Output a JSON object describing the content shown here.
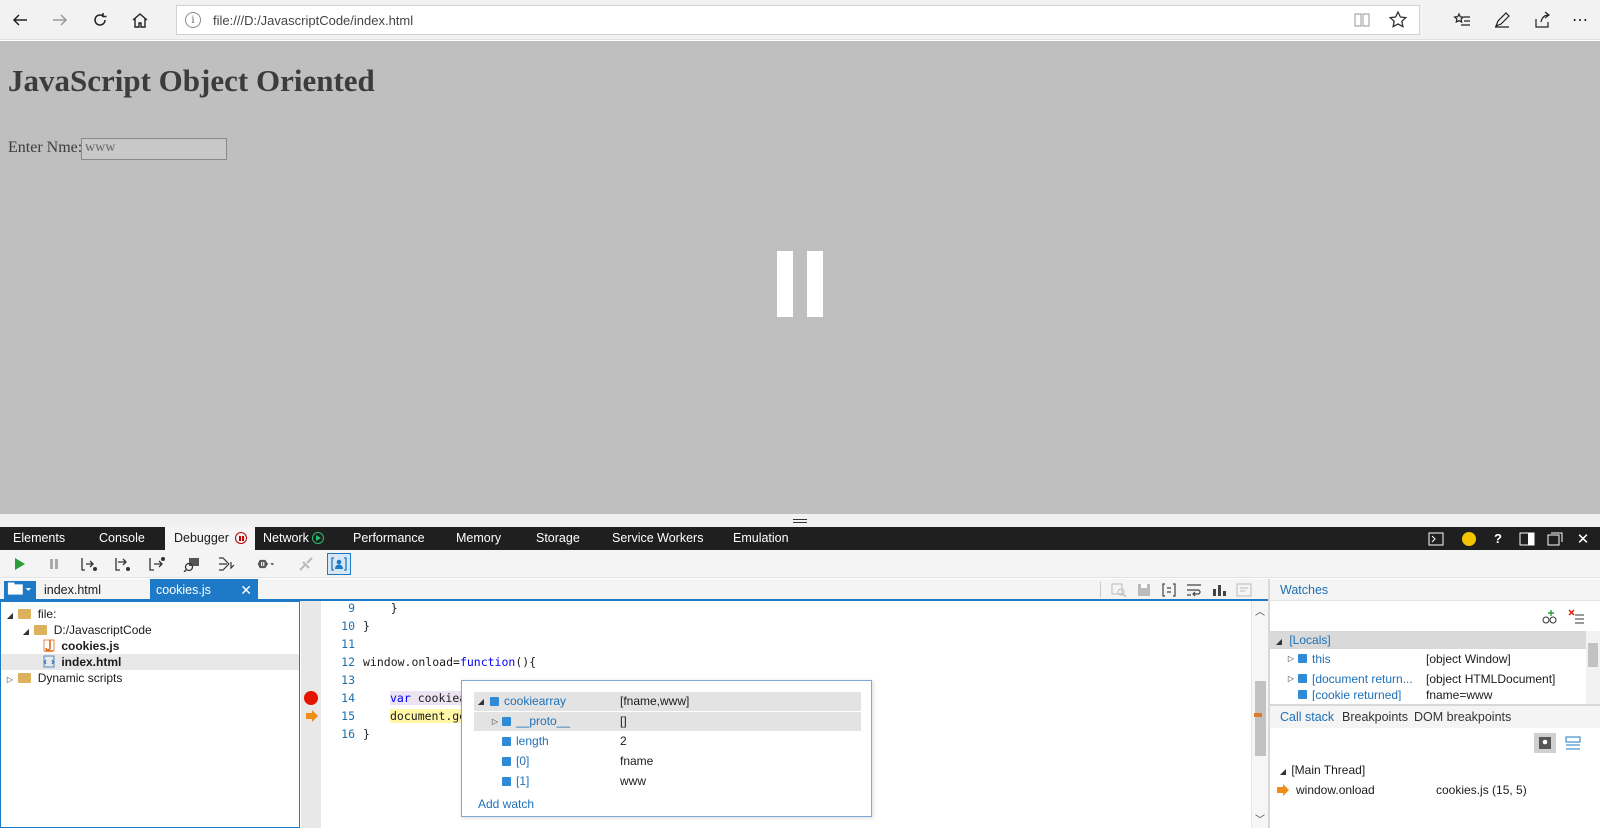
{
  "browser": {
    "url": "file:///D:/JavascriptCode/index.html"
  },
  "page": {
    "heading": "JavaScript Object Oriented",
    "label": "Enter Nme:",
    "input_value": "www"
  },
  "devtools": {
    "tabs": [
      "Elements",
      "Console",
      "Debugger",
      "Network",
      "Performance",
      "Memory",
      "Storage",
      "Service Workers",
      "Emulation"
    ],
    "active_tab": "Debugger"
  },
  "files": {
    "tabs": [
      "index.html",
      "cookies.js"
    ],
    "active": "cookies.js",
    "tree": {
      "root": "file:",
      "folder": "D:/JavascriptCode",
      "file1": "cookies.js",
      "file2": "index.html",
      "dynamic": "Dynamic scripts"
    }
  },
  "code": {
    "lines": [
      {
        "n": "9",
        "text": "    }"
      },
      {
        "n": "10",
        "text": "}"
      },
      {
        "n": "11",
        "text": ""
      },
      {
        "n": "12",
        "pre": "window.onload=",
        "kw": "function",
        "post": "(){"
      },
      {
        "n": "13",
        "text": ""
      },
      {
        "n": "14",
        "kw": "var",
        "post": " cookiea"
      },
      {
        "n": "15",
        "hl": "document.ge"
      },
      {
        "n": "16",
        "text": "}"
      }
    ]
  },
  "datatip": {
    "rows": [
      {
        "name": "cookiearray",
        "value": "[fname,www]"
      },
      {
        "name": "__proto__",
        "value": "[]"
      },
      {
        "name": "length",
        "value": "2"
      },
      {
        "name": "[0]",
        "value": "fname"
      },
      {
        "name": "[1]",
        "value": "www"
      }
    ],
    "add_watch": "Add watch"
  },
  "watches": {
    "title": "Watches",
    "locals": "[Locals]",
    "rows": [
      {
        "name": "this",
        "value": "[object Window]"
      },
      {
        "name": "[document return...",
        "value": "[object HTMLDocument]"
      },
      {
        "name": "[cookie returned]",
        "value": "fname=www"
      }
    ]
  },
  "callstack": {
    "tabs": [
      "Call stack",
      "Breakpoints",
      "DOM breakpoints"
    ],
    "thread": "[Main Thread]",
    "frame": "window.onload",
    "location": "cookies.js (15, 5)"
  },
  "colors": {
    "accent": "#1e7ac6",
    "breakpoint": "#e51400",
    "current_line": "#fff7a6",
    "arrow": "#f08c1a"
  }
}
